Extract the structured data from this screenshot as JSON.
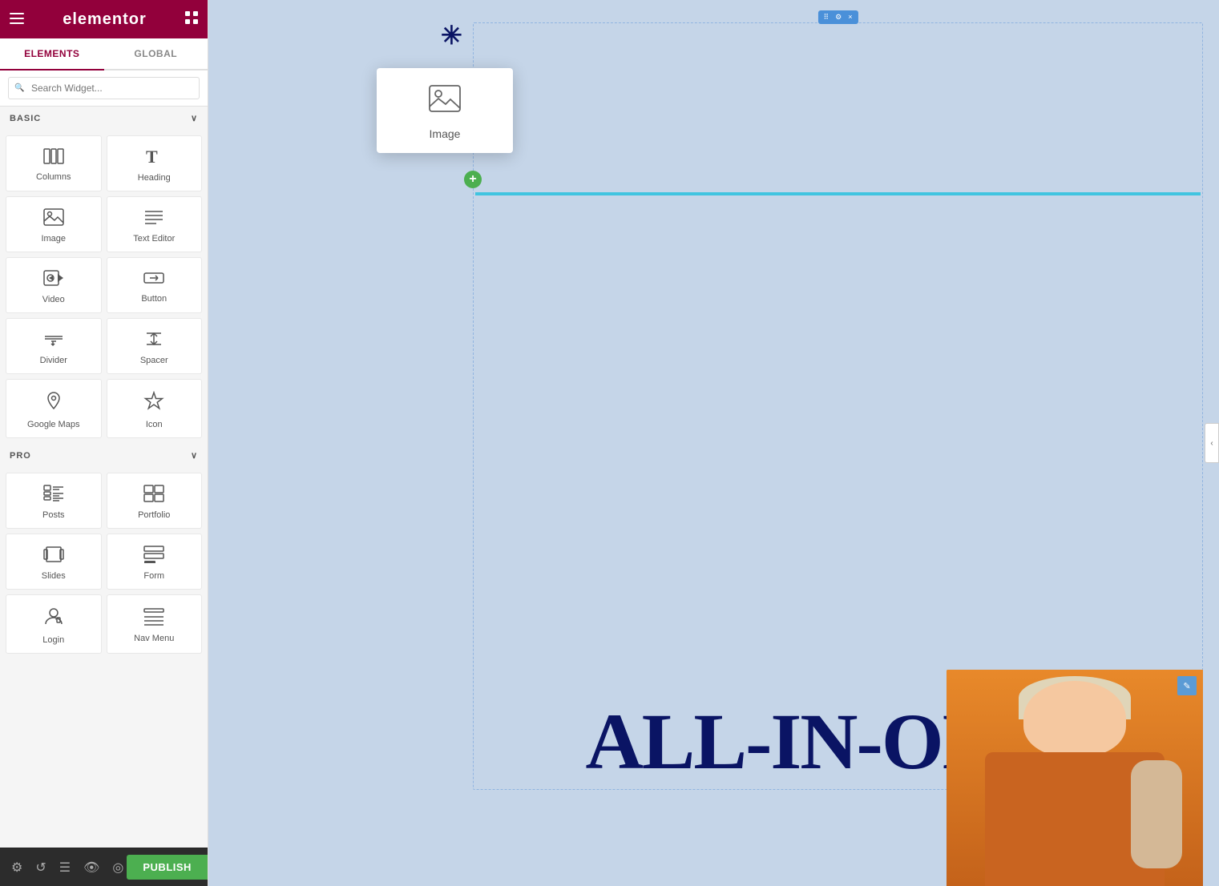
{
  "header": {
    "title": "elementor",
    "hamburger_label": "☰",
    "grid_label": "⊞"
  },
  "sidebar": {
    "tabs": [
      {
        "id": "elements",
        "label": "ELEMENTS",
        "active": true
      },
      {
        "id": "global",
        "label": "GLOBAL",
        "active": false
      }
    ],
    "search_placeholder": "Search Widget...",
    "sections": [
      {
        "id": "basic",
        "label": "BASIC",
        "collapsed": false,
        "widgets": [
          {
            "id": "columns",
            "label": "Columns",
            "icon": "columns"
          },
          {
            "id": "heading",
            "label": "Heading",
            "icon": "heading"
          },
          {
            "id": "image",
            "label": "Image",
            "icon": "image"
          },
          {
            "id": "text-editor",
            "label": "Text Editor",
            "icon": "text-editor"
          },
          {
            "id": "video",
            "label": "Video",
            "icon": "video"
          },
          {
            "id": "button",
            "label": "Button",
            "icon": "button"
          },
          {
            "id": "divider",
            "label": "Divider",
            "icon": "divider"
          },
          {
            "id": "spacer",
            "label": "Spacer",
            "icon": "spacer"
          },
          {
            "id": "google-maps",
            "label": "Google Maps",
            "icon": "google-maps"
          },
          {
            "id": "icon",
            "label": "Icon",
            "icon": "icon"
          }
        ]
      },
      {
        "id": "pro",
        "label": "PRO",
        "collapsed": false,
        "widgets": [
          {
            "id": "posts",
            "label": "Posts",
            "icon": "posts"
          },
          {
            "id": "portfolio",
            "label": "Portfolio",
            "icon": "portfolio"
          },
          {
            "id": "slides",
            "label": "Slides",
            "icon": "slides"
          },
          {
            "id": "form",
            "label": "Form",
            "icon": "form"
          },
          {
            "id": "login",
            "label": "Login",
            "icon": "login"
          },
          {
            "id": "nav-menu",
            "label": "Nav Menu",
            "icon": "nav-menu"
          }
        ]
      }
    ]
  },
  "canvas": {
    "drag_widget": {
      "label": "Image",
      "icon": "image"
    },
    "main_text": "ALL-IN-ONE",
    "section_toolbar": {
      "move": "⠿",
      "settings": "⚙",
      "close": "×"
    }
  },
  "bottom_toolbar": {
    "tools": [
      {
        "id": "settings",
        "icon": "⚙",
        "label": "Settings"
      },
      {
        "id": "history",
        "icon": "↺",
        "label": "History"
      },
      {
        "id": "responsive",
        "icon": "☰",
        "label": "Responsive"
      },
      {
        "id": "preview",
        "icon": "👁",
        "label": "Preview"
      },
      {
        "id": "display",
        "icon": "◎",
        "label": "Display"
      }
    ],
    "publish_label": "PUBLISH"
  }
}
